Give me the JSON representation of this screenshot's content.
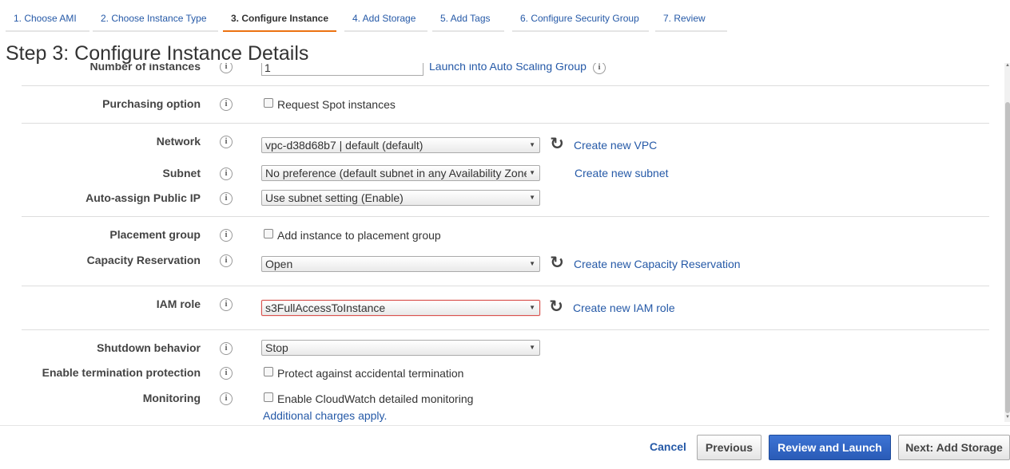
{
  "tabs": [
    {
      "label": "1. Choose AMI"
    },
    {
      "label": "2. Choose Instance Type"
    },
    {
      "label": "3. Configure Instance"
    },
    {
      "label": "4. Add Storage"
    },
    {
      "label": "5. Add Tags"
    },
    {
      "label": "6. Configure Security Group"
    },
    {
      "label": "7. Review"
    }
  ],
  "active_tab": "3. Configure Instance",
  "page_title": "Step 3: Configure Instance Details",
  "form": {
    "number_of_instances": {
      "label": "Number of instances",
      "value": "1",
      "link": "Launch into Auto Scaling Group"
    },
    "purchasing_option": {
      "label": "Purchasing option",
      "checkbox": "Request Spot instances",
      "checked": false
    },
    "network": {
      "label": "Network",
      "value": "vpc-d38d68b7 | default (default)",
      "link": "Create new VPC"
    },
    "subnet": {
      "label": "Subnet",
      "value": "No preference (default subnet in any Availability Zone)",
      "link": "Create new subnet"
    },
    "public_ip": {
      "label": "Auto-assign Public IP",
      "value": "Use subnet setting (Enable)"
    },
    "placement_group": {
      "label": "Placement group",
      "checkbox": "Add instance to placement group",
      "checked": false
    },
    "capacity_reservation": {
      "label": "Capacity Reservation",
      "value": "Open",
      "link": "Create new Capacity Reservation"
    },
    "iam_role": {
      "label": "IAM role",
      "value": "s3FullAccessToInstance",
      "link": "Create new IAM role"
    },
    "shutdown_behavior": {
      "label": "Shutdown behavior",
      "value": "Stop"
    },
    "termination_protection": {
      "label": "Enable termination protection",
      "checkbox": "Protect against accidental termination",
      "checked": false
    },
    "monitoring": {
      "label": "Monitoring",
      "checkbox": "Enable CloudWatch detailed monitoring",
      "checked": false,
      "note": "Additional charges apply."
    }
  },
  "info_glyph": "i",
  "footer": {
    "cancel": "Cancel",
    "previous": "Previous",
    "review_launch": "Review and Launch",
    "next": "Next: Add Storage"
  },
  "colors": {
    "link": "#2559a7",
    "active_tab_underline": "#ec7211",
    "primary_button": "#2a5bb7",
    "error_border": "#d9534f"
  },
  "icons": [
    "info-icon",
    "refresh-icon",
    "dropdown-caret-icon",
    "checkbox-icon"
  ]
}
